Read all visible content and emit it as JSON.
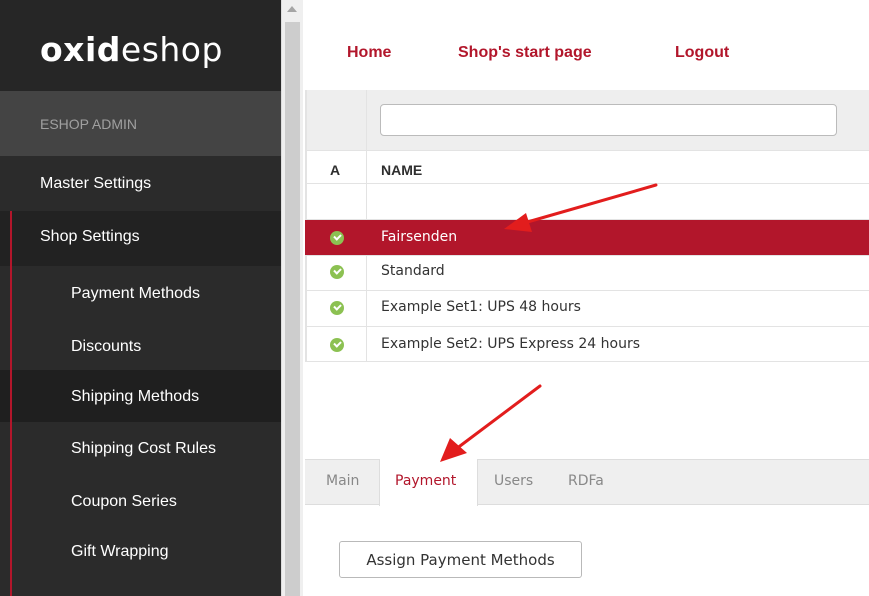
{
  "colors": {
    "accent": "#b2162b",
    "sidebar_bg": "#2b2b2b",
    "active_check": "#8cc152"
  },
  "logo": {
    "bold": "oxid",
    "thin": "eshop"
  },
  "sidebar": {
    "section_title": "ESHOP ADMIN",
    "items": [
      {
        "label": "Master Settings",
        "level": 1
      },
      {
        "label": "Shop Settings",
        "level": 1
      },
      {
        "label": "Payment Methods",
        "level": 2
      },
      {
        "label": "Discounts",
        "level": 2
      },
      {
        "label": "Shipping Methods",
        "level": 2,
        "selected": true
      },
      {
        "label": "Shipping Cost Rules",
        "level": 2
      },
      {
        "label": "Coupon Series",
        "level": 2
      },
      {
        "label": "Gift Wrapping",
        "level": 2
      }
    ]
  },
  "topnav": {
    "home": "Home",
    "start": "Shop's start page",
    "logout": "Logout"
  },
  "list": {
    "search": {
      "value": "",
      "placeholder": ""
    },
    "columns": {
      "active": "A",
      "name": "NAME"
    },
    "rows": [
      {
        "name": "Fairsenden",
        "active": true,
        "selected": true
      },
      {
        "name": "Standard",
        "active": true
      },
      {
        "name": "Example Set1: UPS 48 hours",
        "active": true
      },
      {
        "name": "Example Set2: UPS Express 24 hours",
        "active": true
      }
    ]
  },
  "tabs": [
    "Main",
    "Payment",
    "Users",
    "RDFa"
  ],
  "selected_tab": "Payment",
  "assign_button": "Assign Payment Methods"
}
